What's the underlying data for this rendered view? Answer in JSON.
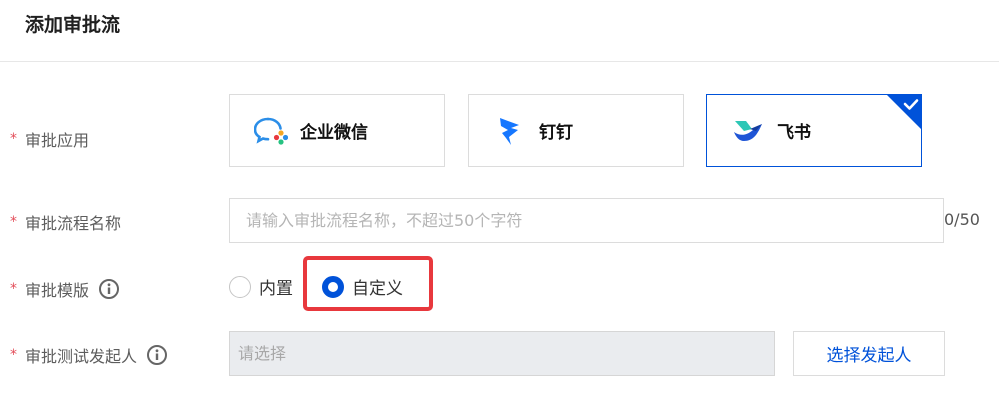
{
  "page": {
    "title": "添加审批流"
  },
  "approval_app": {
    "label": "审批应用",
    "required": "*",
    "options": [
      {
        "name": "企业微信",
        "icon": "wecom-logo-icon",
        "selected": false
      },
      {
        "name": "钉钉",
        "icon": "dingtalk-logo-icon",
        "selected": false
      },
      {
        "name": "飞书",
        "icon": "feishu-logo-icon",
        "selected": true
      }
    ]
  },
  "flow_name": {
    "label": "审批流程名称",
    "required": "*",
    "placeholder": "请输入审批流程名称，不超过50个字符",
    "value": "",
    "counter": "0/50"
  },
  "template": {
    "label": "审批模版",
    "required": "*",
    "options": [
      {
        "label": "内置",
        "checked": false
      },
      {
        "label": "自定义",
        "checked": true
      }
    ]
  },
  "test_initiator": {
    "label": "审批测试发起人",
    "required": "*",
    "placeholder": "请选择",
    "button_label": "选择发起人"
  },
  "colors": {
    "primary": "#0052d9",
    "required": "#e34d59",
    "highlight": "#e8383d"
  }
}
